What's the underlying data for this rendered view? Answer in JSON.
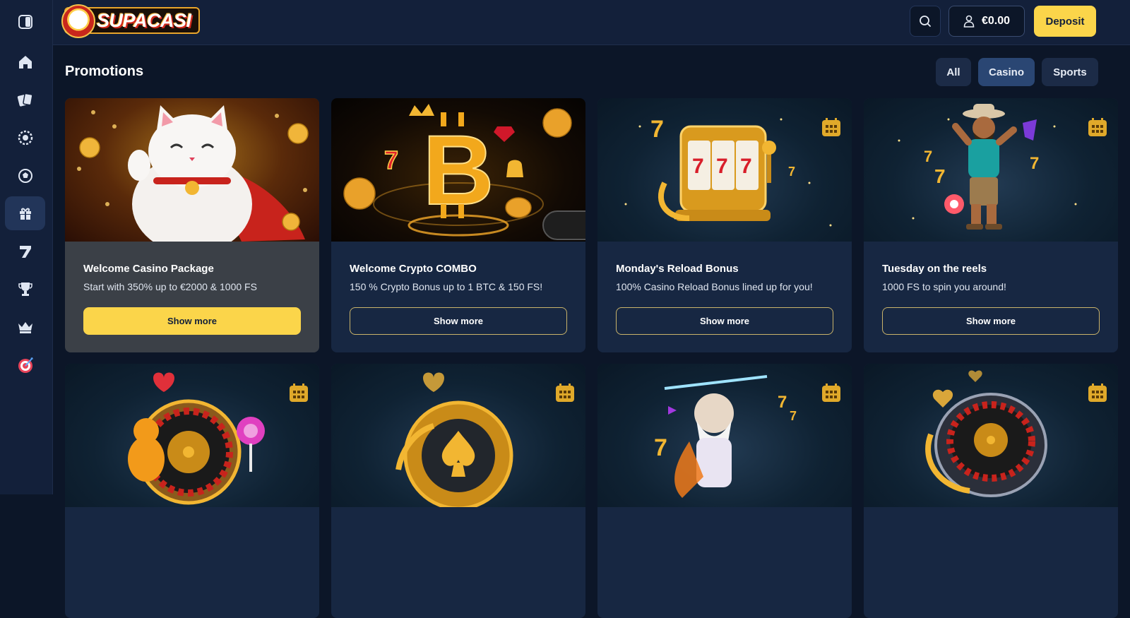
{
  "app": {
    "logo_text": "SUPACASI"
  },
  "sidebar": {
    "items": [
      {
        "icon": "sidebar-toggle-icon"
      },
      {
        "icon": "home-icon"
      },
      {
        "icon": "cards-icon"
      },
      {
        "icon": "live-casino-icon"
      },
      {
        "icon": "sports-ball-icon"
      },
      {
        "icon": "gift-icon",
        "active": true
      },
      {
        "icon": "seven-icon"
      },
      {
        "icon": "trophy-icon"
      },
      {
        "icon": "crown-icon"
      },
      {
        "icon": "target-icon"
      }
    ]
  },
  "header": {
    "balance": "€0.00",
    "deposit_label": "Deposit"
  },
  "main": {
    "title": "Promotions",
    "filters": [
      {
        "label": "All",
        "active": false
      },
      {
        "label": "Casino",
        "active": true
      },
      {
        "label": "Sports",
        "active": false
      }
    ],
    "promotions": [
      {
        "title": "Welcome Casino Package",
        "description": "Start with 350% up to €2000 & 1000 FS",
        "button": "Show more",
        "primary": true
      },
      {
        "title": "Welcome Crypto COMBO",
        "description": "150 % Crypto Bonus up to 1 BTC & 150 FS!",
        "button": "Show more",
        "primary": false
      },
      {
        "title": "Monday's Reload Bonus",
        "description": "100% Casino Reload Bonus lined up for you!",
        "button": "Show more",
        "primary": false
      },
      {
        "title": "Tuesday on the reels",
        "description": "1000 FS to spin you around!",
        "button": "Show more",
        "primary": false
      }
    ]
  },
  "colors": {
    "accent": "#fbd54a",
    "background": "#0c1628",
    "sidebar": "#13203a",
    "card": "#172742"
  }
}
